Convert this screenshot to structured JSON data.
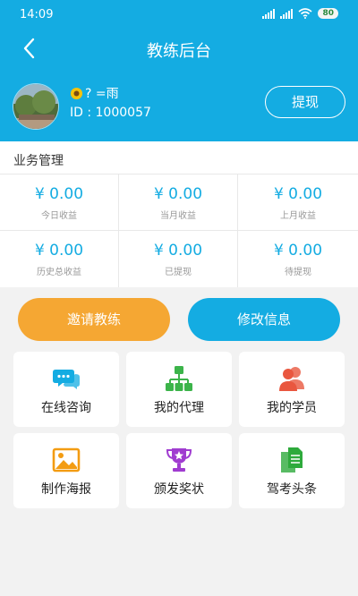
{
  "status_bar": {
    "time": "14:09",
    "battery": "80"
  },
  "header": {
    "title": "教练后台"
  },
  "profile": {
    "nickname": "? =雨",
    "nickname_icon": "sunflower",
    "id_text": "ID : 1000057",
    "withdraw_label": "提现"
  },
  "stats": {
    "title": "业务管理",
    "items": [
      {
        "value": "¥ 0.00",
        "label": "今日收益"
      },
      {
        "value": "¥ 0.00",
        "label": "当月收益"
      },
      {
        "value": "¥ 0.00",
        "label": "上月收益"
      },
      {
        "value": "¥ 0.00",
        "label": "历史总收益"
      },
      {
        "value": "¥ 0.00",
        "label": "已提现"
      },
      {
        "value": "¥ 0.00",
        "label": "待提现"
      }
    ]
  },
  "actions": {
    "invite_label": "邀请教练",
    "edit_label": "修改信息"
  },
  "menu": [
    {
      "label": "在线咨询",
      "icon": "chat-icon",
      "color": "#14ace2"
    },
    {
      "label": "我的代理",
      "icon": "agent-tree-icon",
      "color": "#3cb44a"
    },
    {
      "label": "我的学员",
      "icon": "students-icon",
      "color": "#e9573f"
    },
    {
      "label": "制作海报",
      "icon": "poster-image-icon",
      "color": "#f39c12"
    },
    {
      "label": "颁发奖状",
      "icon": "trophy-icon",
      "color": "#a03cd0"
    },
    {
      "label": "驾考头条",
      "icon": "documents-icon",
      "color": "#2eaa3c"
    }
  ],
  "colors": {
    "primary": "#14ace2",
    "accent": "#f5a733"
  }
}
